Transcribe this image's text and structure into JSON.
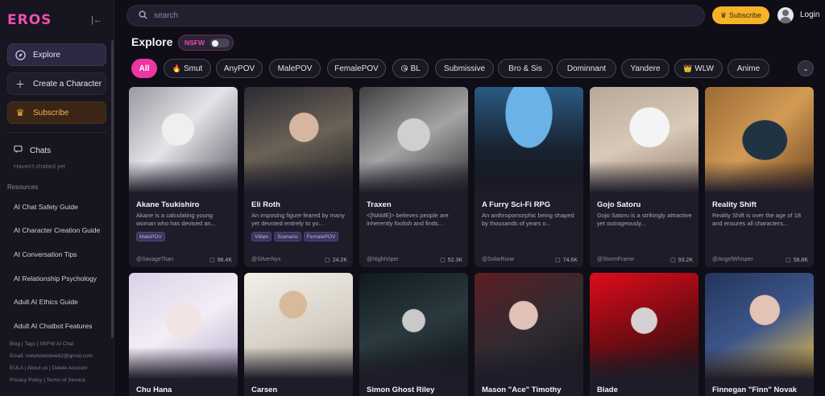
{
  "sidebar": {
    "logo": "EROS",
    "explore_label": "Explore",
    "create_label": "Create a Character",
    "subscribe_label": "Subscribe",
    "chats_label": "Chats",
    "chats_sub": "Haven't chatted yet",
    "resources_title": "Resources",
    "resources": [
      "AI Chat Safety Guide",
      "AI Character Creation Guide",
      "AI Conversation Tips",
      "AI Relationship Psychology",
      "Adult AI Ethics Guide",
      "Adult AI Chatbot Features"
    ],
    "footer": {
      "line1": "Blog | Tags | NSFW AI Chat",
      "line2": "Email: notwhitetotweb2@gmail.com",
      "line3": "EULA | About us | Delete Account",
      "line4": "Privacy Policy | Terms of Service"
    }
  },
  "topbar": {
    "search_placeholder": "search",
    "subscribe_label": "Subscribe",
    "login_label": "Login"
  },
  "explore": {
    "title": "Explore",
    "nsfw_label": "NSFW"
  },
  "tags": [
    {
      "label": "All",
      "emoji": ""
    },
    {
      "label": "Smut",
      "emoji": "🔥"
    },
    {
      "label": "AnyPOV",
      "emoji": ""
    },
    {
      "label": "MalePOV",
      "emoji": ""
    },
    {
      "label": "FemalePOV",
      "emoji": ""
    },
    {
      "label": "BL",
      "emoji": "😘"
    },
    {
      "label": "Submissive",
      "emoji": ""
    },
    {
      "label": "Bro & Sis",
      "emoji": ""
    },
    {
      "label": "Dominnant",
      "emoji": ""
    },
    {
      "label": "Yandere",
      "emoji": ""
    },
    {
      "label": "WLW",
      "emoji": "👑"
    },
    {
      "label": "Anime",
      "emoji": ""
    }
  ],
  "cards": [
    {
      "name": "Akane Tsukishiro",
      "desc": "Akane is a calculating young woman who has devised an...",
      "tags": [
        "MalePOV"
      ],
      "user": "@SavageTitan",
      "count": "96.4K"
    },
    {
      "name": "Eli Roth",
      "desc": "An imposing figure feared by many yet devoted entirely to yo...",
      "tags": [
        "Villain",
        "Scenario",
        "FemalePOV"
      ],
      "user": "@SilverNyx",
      "count": "24.2K"
    },
    {
      "name": "Traxen",
      "desc": "<[NAME]> believes people are inherently foolish and finds...",
      "tags": [],
      "user": "@NightViper",
      "count": "52.3K"
    },
    {
      "name": "A Furry Sci-Fi RPG",
      "desc": "An anthropomorphic being shaped by thousands of years o...",
      "tags": [],
      "user": "@SolarRune",
      "count": "74.6K"
    },
    {
      "name": "Gojo Satoru",
      "desc": "Gojo Satoru is a strikingly attractive yet outrageously...",
      "tags": [],
      "user": "@StormFrame",
      "count": "93.2K"
    },
    {
      "name": "Reality Shift",
      "desc": "Reality Shift is over the age of 18 and ensures all characters...",
      "tags": [],
      "user": "@AngelWhisper",
      "count": "58.8K"
    },
    {
      "name": "Chu Hana"
    },
    {
      "name": "Carsen"
    },
    {
      "name": "Simon Ghost Riley"
    },
    {
      "name": "Mason \"Ace\" Timothy"
    },
    {
      "name": "Blade"
    },
    {
      "name": "Finnegan \"Finn\" Novak"
    }
  ]
}
